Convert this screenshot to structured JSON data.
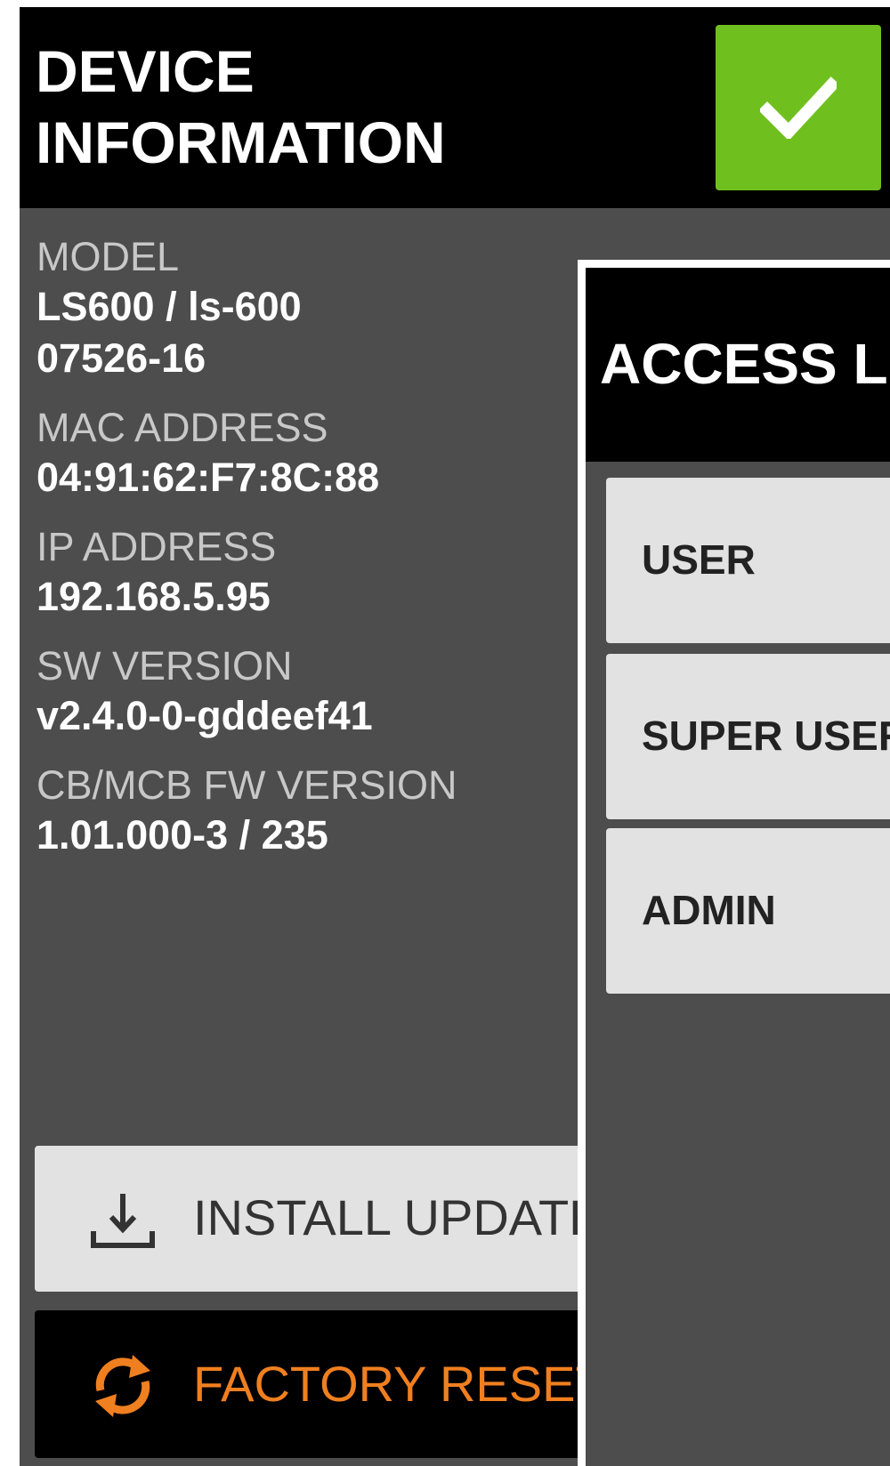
{
  "header": {
    "title": "DEVICE\nINFORMATION",
    "confirm_icon": "checkmark-icon",
    "confirm_color": "#6fc01e"
  },
  "info": [
    {
      "label": "MODEL",
      "values": [
        "LS600 / ls-600",
        "07526-16"
      ]
    },
    {
      "label": "MAC ADDRESS",
      "values": [
        "04:91:62:F7:8C:88"
      ]
    },
    {
      "label": "IP ADDRESS",
      "values": [
        "192.168.5.95"
      ]
    },
    {
      "label": "SW VERSION",
      "values": [
        "v2.4.0-0-gddeef41"
      ]
    },
    {
      "label": "CB/MCB FW VERSION",
      "values": [
        "1.01.000-3 / 235"
      ]
    }
  ],
  "actions": {
    "install_update": {
      "label": "INSTALL UPDATE",
      "icon": "download-icon"
    },
    "factory_reset": {
      "label": "FACTORY RESET",
      "icon": "refresh-icon",
      "color": "#f07f1f"
    }
  },
  "access_dialog": {
    "title": "ACCESS L",
    "options": [
      "USER",
      "SUPER USER",
      "ADMIN"
    ]
  }
}
